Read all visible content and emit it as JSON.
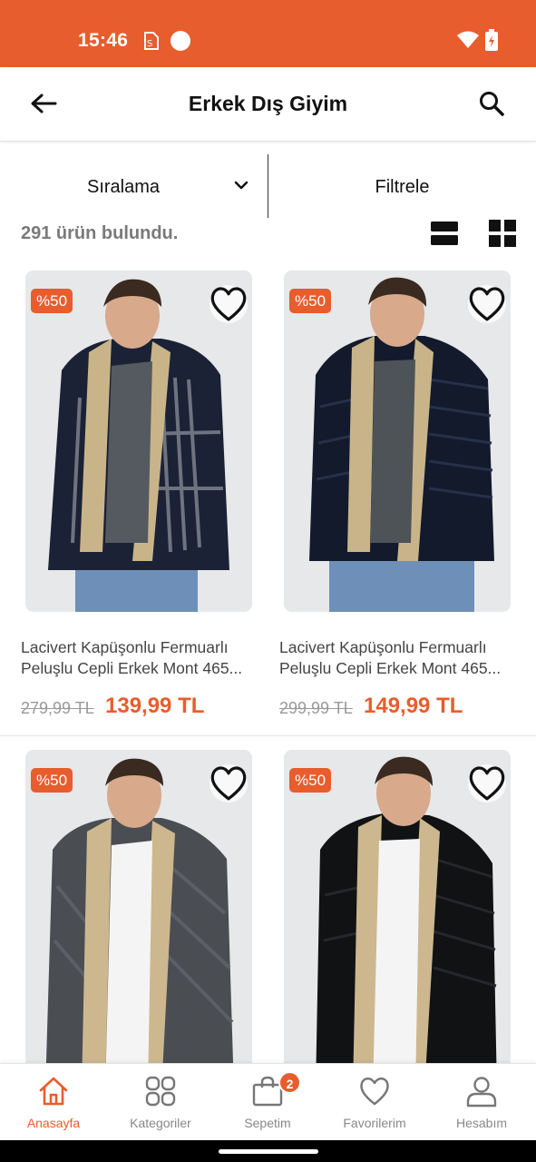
{
  "status_bar": {
    "time": "15:46",
    "background": "#E85D2D"
  },
  "app_bar": {
    "title": "Erkek Dış Giyim",
    "back_icon": "arrow-left-icon",
    "search_icon": "search-icon"
  },
  "toolbar": {
    "sort_label": "Sıralama",
    "filter_label": "Filtrele"
  },
  "results": {
    "count_text": "291 ürün bulundu."
  },
  "products": [
    {
      "discount": "%50",
      "name_line1": "Lacivert Kapüşonlu Fermuarlı",
      "name_line2": "Peluşlu Cepli Erkek Mont 465...",
      "old_price": "279,99 TL",
      "new_price": "139,99 TL"
    },
    {
      "discount": "%50",
      "name_line1": "Lacivert Kapüşonlu Fermuarlı",
      "name_line2": "Peluşlu Cepli Erkek Mont 465...",
      "old_price": "299,99 TL",
      "new_price": "149,99 TL"
    },
    {
      "discount": "%50"
    },
    {
      "discount": "%50"
    }
  ],
  "bottom_nav": {
    "items": [
      {
        "label": "Anasayfa",
        "icon": "home-icon",
        "active": true
      },
      {
        "label": "Kategoriler",
        "icon": "grid-categories-icon",
        "active": false
      },
      {
        "label": "Sepetim",
        "icon": "shopping-bag-icon",
        "active": false
      },
      {
        "label": "Favorilerim",
        "icon": "heart-icon",
        "active": false
      },
      {
        "label": "Hesabım",
        "icon": "user-icon",
        "active": false
      }
    ],
    "cart_count": "2"
  },
  "colors": {
    "accent": "#E85D2D",
    "muted_text": "#7a7a7a"
  }
}
